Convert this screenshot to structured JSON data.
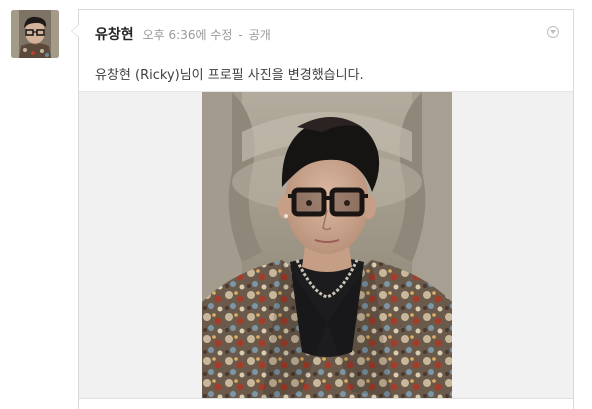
{
  "post": {
    "author": "유창현",
    "time": "오후 6:36에 수정",
    "separator": "-",
    "visibility": "공개",
    "content": "유창현 (Ricky)님이 프로필 사진을 변경했습니다."
  },
  "icons": {
    "menu": "chevron-down-circle-icon"
  },
  "colors": {
    "author": "#262626",
    "meta": "#999999",
    "body_text": "#404040",
    "border": "#d9d9d9",
    "photo_background": "#f1f1f1"
  }
}
